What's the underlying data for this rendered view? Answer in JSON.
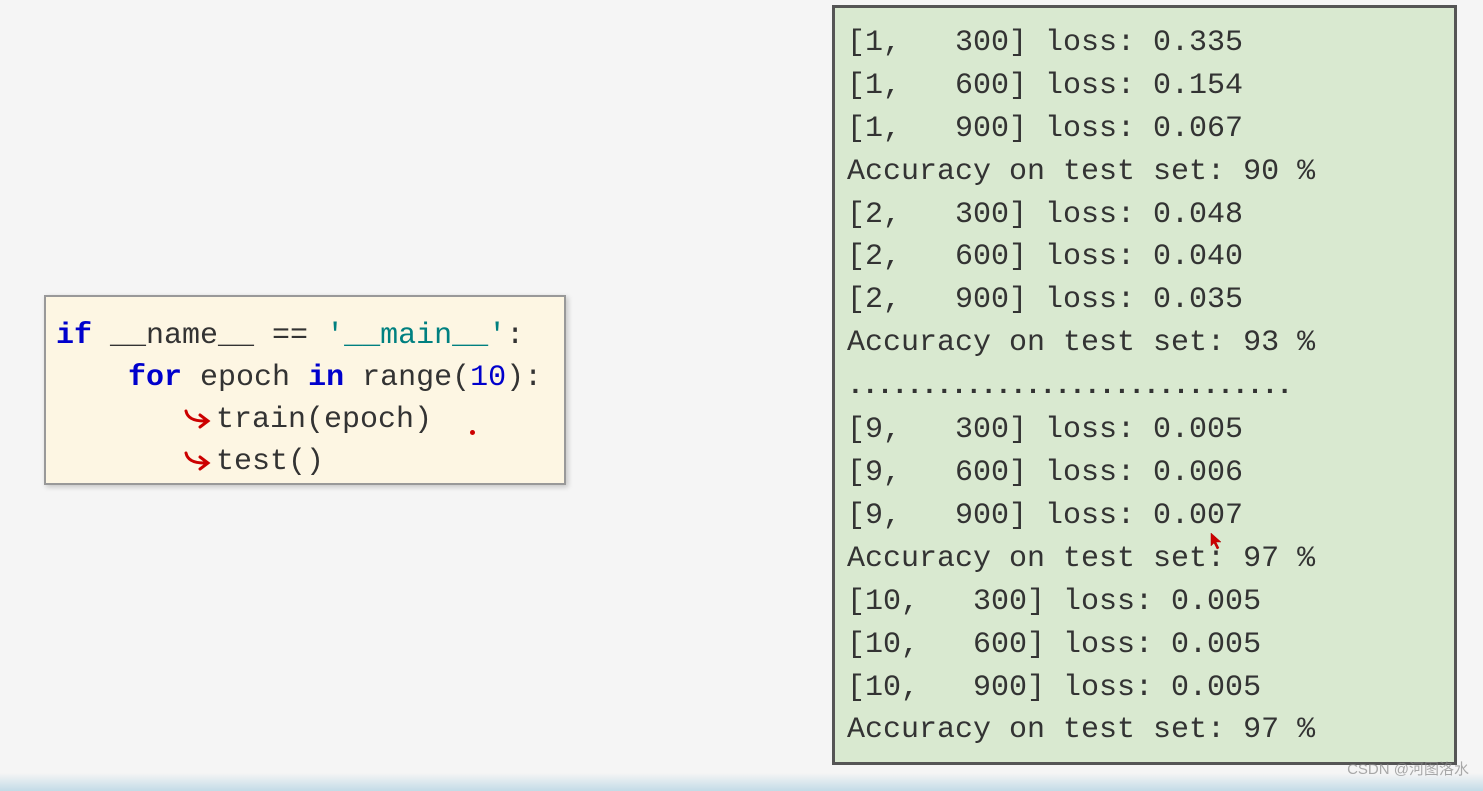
{
  "code": {
    "line1_if": "if",
    "line1_name": " __name__ ",
    "line1_eq": "== ",
    "line1_main": "'__main__'",
    "line1_colon": ":",
    "line2_indent": "    ",
    "line2_for": "for",
    "line2_epoch": " epoch ",
    "line2_in": "in",
    "line2_range": " range(",
    "line2_num": "10",
    "line2_close": "):",
    "line3_indent": "       ",
    "line3_text": "train(epoch)",
    "line4_indent": "       ",
    "line4_text": "test()"
  },
  "output": {
    "lines": [
      "[1,   300] loss: 0.335",
      "[1,   600] loss: 0.154",
      "[1,   900] loss: 0.067",
      "Accuracy on test set: 90 %",
      "[2,   300] loss: 0.048",
      "[2,   600] loss: 0.040",
      "[2,   900] loss: 0.035",
      "Accuracy on test set: 93 %"
    ],
    "dots": "..............................",
    "lines2": [
      "[9,   300] loss: 0.005",
      "[9,   600] loss: 0.006",
      "[9,   900] loss: 0.007",
      "Accuracy on test set: 97 %",
      "[10,   300] loss: 0.005",
      "[10,   600] loss: 0.005",
      "[10,   900] loss: 0.005",
      "Accuracy on test set: 97 %"
    ]
  },
  "watermark": "CSDN @河图洛水"
}
